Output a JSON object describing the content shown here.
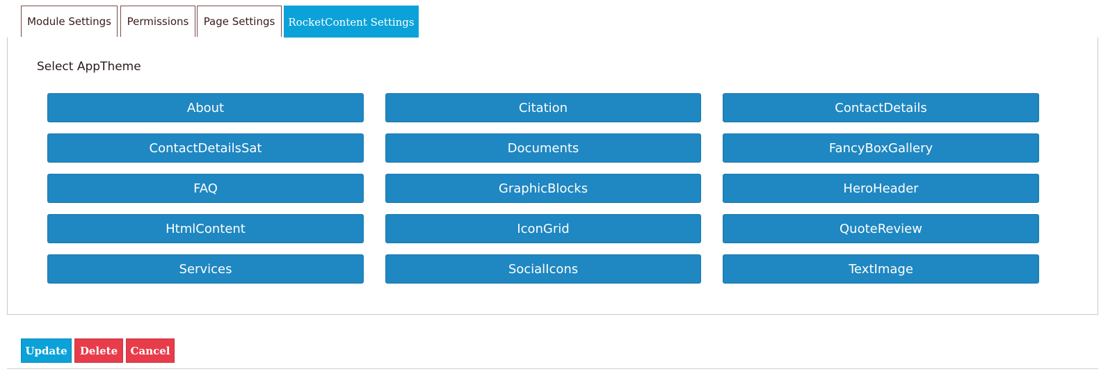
{
  "tabs": [
    {
      "label": "Module Settings",
      "active": false
    },
    {
      "label": "Permissions",
      "active": false
    },
    {
      "label": "Page Settings",
      "active": false
    },
    {
      "label": "RocketContent Settings",
      "active": true
    }
  ],
  "panel": {
    "section_label": "Select AppTheme",
    "themes": [
      "About",
      "Citation",
      "ContactDetails",
      "ContactDetailsSat",
      "Documents",
      "FancyBoxGallery",
      "FAQ",
      "GraphicBlocks",
      "HeroHeader",
      "HtmlContent",
      "IconGrid",
      "QuoteReview",
      "Services",
      "SocialIcons",
      "TextImage"
    ]
  },
  "actions": {
    "update_label": "Update",
    "delete_label": "Delete",
    "cancel_label": "Cancel"
  },
  "colors": {
    "tab_active": "#0aa2d8",
    "theme_button": "#1f87c2",
    "update": "#0aa2d8",
    "delete": "#e83c4a",
    "cancel": "#e83c4a"
  }
}
